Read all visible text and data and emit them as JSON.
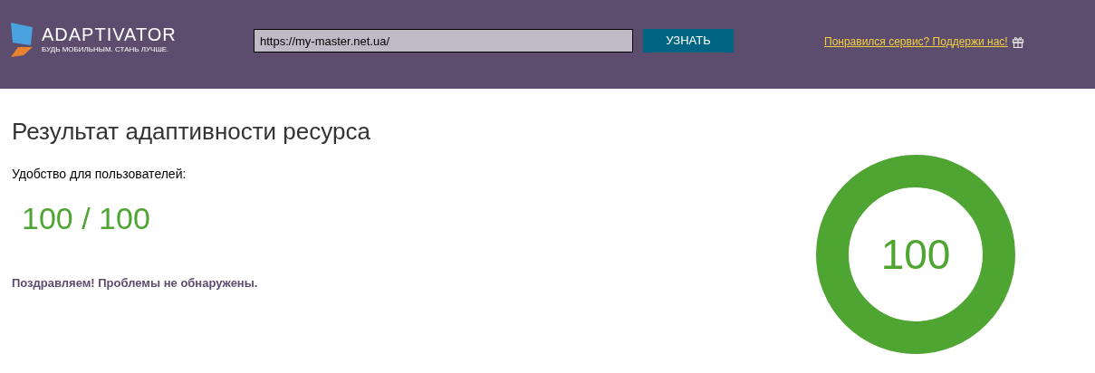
{
  "header": {
    "logo": {
      "name": "ADAPTIVATOR",
      "tagline": "БУДЬ МОБИЛЬНЫМ. СТАНЬ ЛУЧШЕ."
    },
    "url_field": {
      "value": "https://my-master.net.ua/"
    },
    "submit_button": "УЗНАТЬ",
    "support_link": "Понравился сервис? Поддержи нас!"
  },
  "result": {
    "title": "Результат адаптивности ресурса",
    "usability_label": "Удобство для пользователей:",
    "score_text": "100 / 100",
    "message": "Поздравляем! Проблемы не обнаружены.",
    "gauge": {
      "value": "100",
      "level": 1
    }
  }
}
